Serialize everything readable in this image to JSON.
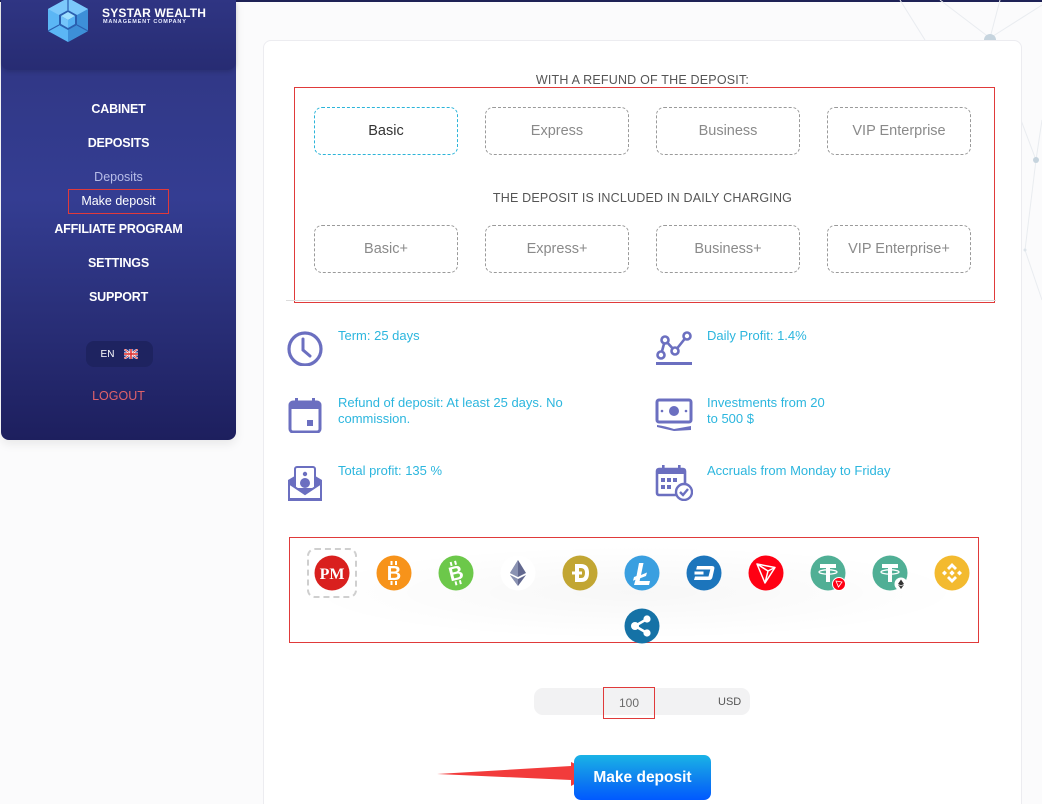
{
  "brand": {
    "title": "SYSTAR WEALTH",
    "subtitle": "MANAGEMENT COMPANY"
  },
  "sidebar": {
    "items": [
      {
        "label": "CABINET"
      },
      {
        "label": "DEPOSITS"
      },
      {
        "label": "Deposits"
      },
      {
        "label": "Make deposit"
      },
      {
        "label": "AFFILIATE PROGRAM"
      },
      {
        "label": "SETTINGS"
      },
      {
        "label": "SUPPORT"
      }
    ],
    "language": {
      "code": "EN",
      "flag_icon": "uk-flag-icon"
    },
    "logout_label": "LOGOUT"
  },
  "plans": {
    "refund_title": "WITH A REFUND OF THE DEPOSIT:",
    "refund_plans": [
      "Basic",
      "Express",
      "Business",
      "VIP Enterprise"
    ],
    "daily_title": "THE DEPOSIT IS INCLUDED IN DAILY CHARGING",
    "daily_plans": [
      "Basic+",
      "Express+",
      "Business+",
      "VIP Enterprise+"
    ],
    "selected": "Basic"
  },
  "features": {
    "term": {
      "text": "Term: 25 days",
      "icon": "clock-icon"
    },
    "daily_profit": {
      "text": "Daily Profit: 1.4%",
      "icon": "chart-line-icon"
    },
    "refund": {
      "text": "Refund of deposit: At least 25 days. No commission.",
      "icon": "calendar-icon"
    },
    "investments": {
      "line1": "Investments from 20",
      "line2": "to 500 $",
      "icon": "banknote-icon"
    },
    "total_profit": {
      "text": "Total profit: 135 %",
      "icon": "money-envelope-icon"
    },
    "accruals": {
      "text": "Accruals from Monday to Friday",
      "icon": "calendar-check-icon"
    }
  },
  "payment_methods": {
    "selected": "Perfect Money",
    "items": [
      {
        "name": "Perfect Money",
        "icon": "perfect-money-icon",
        "label": "PM",
        "color": "#d9201e"
      },
      {
        "name": "Bitcoin",
        "icon": "bitcoin-icon",
        "label": "B",
        "color": "#f7931a"
      },
      {
        "name": "Bitcoin Cash",
        "icon": "bitcoin-cash-icon",
        "label": "B",
        "color": "#6cc84a"
      },
      {
        "name": "Ethereum",
        "icon": "ethereum-icon",
        "label": "",
        "color": "#ffffff"
      },
      {
        "name": "Dogecoin",
        "icon": "dogecoin-icon",
        "label": "Ð",
        "color": "#c2a633"
      },
      {
        "name": "Litecoin",
        "icon": "litecoin-icon",
        "label": "Ł",
        "color": "#3a9fe0"
      },
      {
        "name": "Dash",
        "icon": "dash-icon",
        "label": "D",
        "color": "#1c75bc"
      },
      {
        "name": "Tron",
        "icon": "tron-icon",
        "label": "",
        "color": "#ff0013"
      },
      {
        "name": "Tether TRC20",
        "icon": "tether-trc20-icon",
        "label": "T",
        "color": "#50af95"
      },
      {
        "name": "Tether ERC20",
        "icon": "tether-erc20-icon",
        "label": "T",
        "color": "#50af95"
      },
      {
        "name": "Binance Coin",
        "icon": "binance-icon",
        "label": "",
        "color": "#f3ba2f"
      },
      {
        "name": "Ripple",
        "icon": "ripple-icon",
        "label": "",
        "color": "#1572a6"
      }
    ]
  },
  "amount": {
    "value": "100",
    "currency": "USD"
  },
  "submit_label": "Make deposit"
}
